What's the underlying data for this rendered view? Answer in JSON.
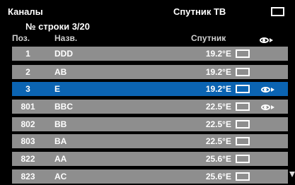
{
  "header": {
    "title": "Каналы",
    "mode": "Спутник ТВ",
    "row_counter": "№ строки 3/20"
  },
  "columns": {
    "position": "Поз.",
    "name": "Назв.",
    "satellite": "Спутник"
  },
  "rows": [
    {
      "pos": "1",
      "name": "DDD",
      "sat": "19.2°E",
      "fav": false,
      "selected": false
    },
    {
      "pos": "2",
      "name": "AB",
      "sat": "19.2°E",
      "fav": false,
      "selected": false
    },
    {
      "pos": "3",
      "name": "E",
      "sat": "19.2°E",
      "fav": true,
      "selected": true
    },
    {
      "pos": "801",
      "name": "BBC",
      "sat": "22.5°E",
      "fav": true,
      "selected": false
    },
    {
      "pos": "802",
      "name": "BB",
      "sat": "22.5°E",
      "fav": false,
      "selected": false
    },
    {
      "pos": "803",
      "name": "BA",
      "sat": "22.5°E",
      "fav": false,
      "selected": false
    },
    {
      "pos": "822",
      "name": "AA",
      "sat": "25.6°E",
      "fav": false,
      "selected": false
    },
    {
      "pos": "823",
      "name": "AC",
      "sat": "25.6°E",
      "fav": false,
      "selected": false
    }
  ],
  "colors": {
    "background": "#000000",
    "row": "#8e8e8e",
    "selected_row": "#0b64b2",
    "text": "#ffffff"
  },
  "icons": {
    "tv_mode": "tv-frame-icon",
    "favorite": "favorite-eye-arrow-icon",
    "satellite_marker": "satellite-box-icon",
    "scroll": "scroll-down-arrow-icon"
  }
}
